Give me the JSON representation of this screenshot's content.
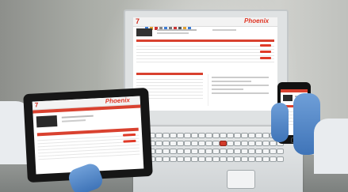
{
  "brand": {
    "name": "Phoenix",
    "mark": "7"
  },
  "colors": {
    "accent": "#e03524",
    "glove": "#4f86c8",
    "terminal": "#dfe2e3"
  },
  "icons": [
    "logo-mark-icon",
    "toolbar-icons",
    "keyboard-keys",
    "glove"
  ]
}
